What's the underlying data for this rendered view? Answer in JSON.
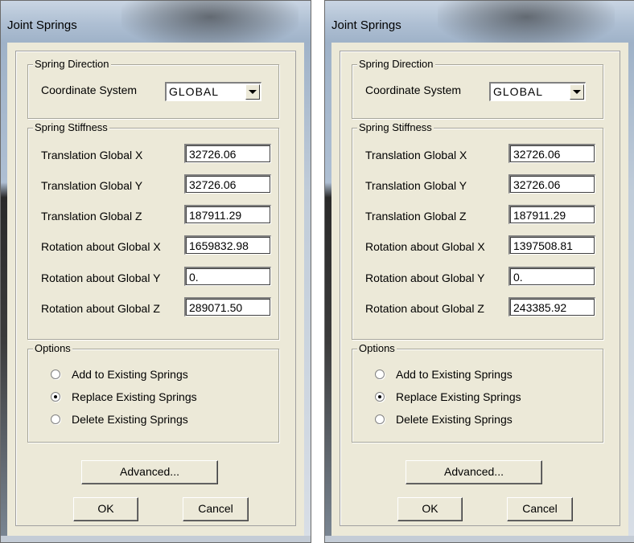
{
  "dialogs": [
    {
      "title": "Joint Springs",
      "spring_direction": {
        "legend": "Spring Direction",
        "coordinate_system_label": "Coordinate System",
        "coordinate_system_value": "GLOBAL"
      },
      "spring_stiffness": {
        "legend": "Spring Stiffness",
        "rows": [
          {
            "label": "Translation Global X",
            "value": "32726.06"
          },
          {
            "label": "Translation Global Y",
            "value": "32726.06"
          },
          {
            "label": "Translation Global Z",
            "value": "187911.29"
          },
          {
            "label": "Rotation about Global X",
            "value": "1659832.98"
          },
          {
            "label": "Rotation about Global Y",
            "value": "0."
          },
          {
            "label": "Rotation about Global Z",
            "value": "289071.50"
          }
        ]
      },
      "options": {
        "legend": "Options",
        "items": [
          {
            "label": "Add to Existing Springs",
            "selected": false
          },
          {
            "label": "Replace Existing Springs",
            "selected": true
          },
          {
            "label": "Delete Existing Springs",
            "selected": false
          }
        ]
      },
      "buttons": {
        "advanced": "Advanced...",
        "ok": "OK",
        "cancel": "Cancel"
      }
    },
    {
      "title": "Joint Springs",
      "spring_direction": {
        "legend": "Spring Direction",
        "coordinate_system_label": "Coordinate System",
        "coordinate_system_value": "GLOBAL"
      },
      "spring_stiffness": {
        "legend": "Spring Stiffness",
        "rows": [
          {
            "label": "Translation Global X",
            "value": "32726.06"
          },
          {
            "label": "Translation Global Y",
            "value": "32726.06"
          },
          {
            "label": "Translation Global Z",
            "value": "187911.29"
          },
          {
            "label": "Rotation about Global X",
            "value": "1397508.81"
          },
          {
            "label": "Rotation about Global Y",
            "value": "0."
          },
          {
            "label": "Rotation about Global Z",
            "value": "243385.92"
          }
        ]
      },
      "options": {
        "legend": "Options",
        "items": [
          {
            "label": "Add to Existing Springs",
            "selected": false
          },
          {
            "label": "Replace Existing Springs",
            "selected": true
          },
          {
            "label": "Delete Existing Springs",
            "selected": false
          }
        ]
      },
      "buttons": {
        "advanced": "Advanced...",
        "ok": "OK",
        "cancel": "Cancel"
      }
    }
  ],
  "colors": {
    "dialog_face": "#ece9d8",
    "titlebar": "#aebfd3"
  },
  "icons": {
    "dropdown": "chevron-down-icon",
    "radio": "radio-button-icon"
  }
}
